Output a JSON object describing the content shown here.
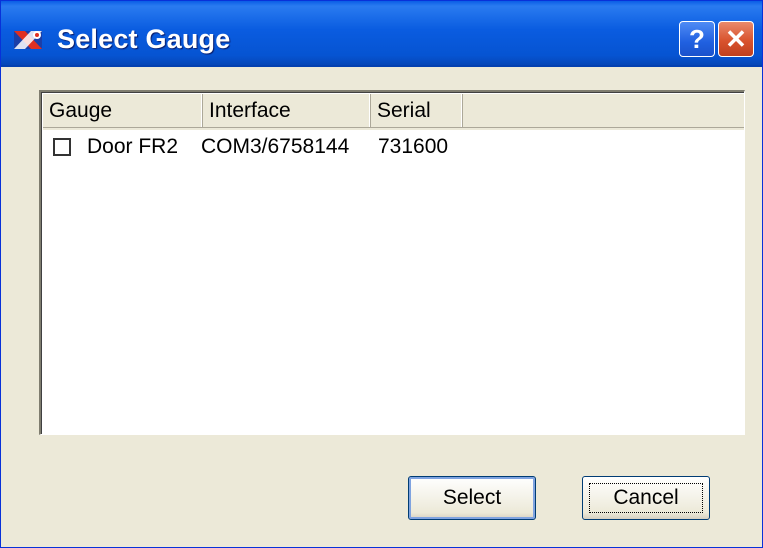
{
  "window": {
    "title": "Select Gauge",
    "help_glyph": "?",
    "close_glyph": "✕"
  },
  "list": {
    "columns": [
      "Gauge",
      "Interface",
      "Serial",
      ""
    ],
    "rows": [
      {
        "gauge": "Door FR2",
        "interface": "COM3/6758144",
        "serial": "731600",
        "checked": false
      }
    ]
  },
  "buttons": {
    "select_label": "Select",
    "cancel_label": "Cancel"
  },
  "colors": {
    "titlebar": "#0a5ce0",
    "close": "#d9532e",
    "face": "#ece9d8"
  },
  "icons": {
    "app": "gauge-app-icon",
    "help": "help-icon",
    "close": "close-icon",
    "checkbox": "checkbox-icon"
  }
}
